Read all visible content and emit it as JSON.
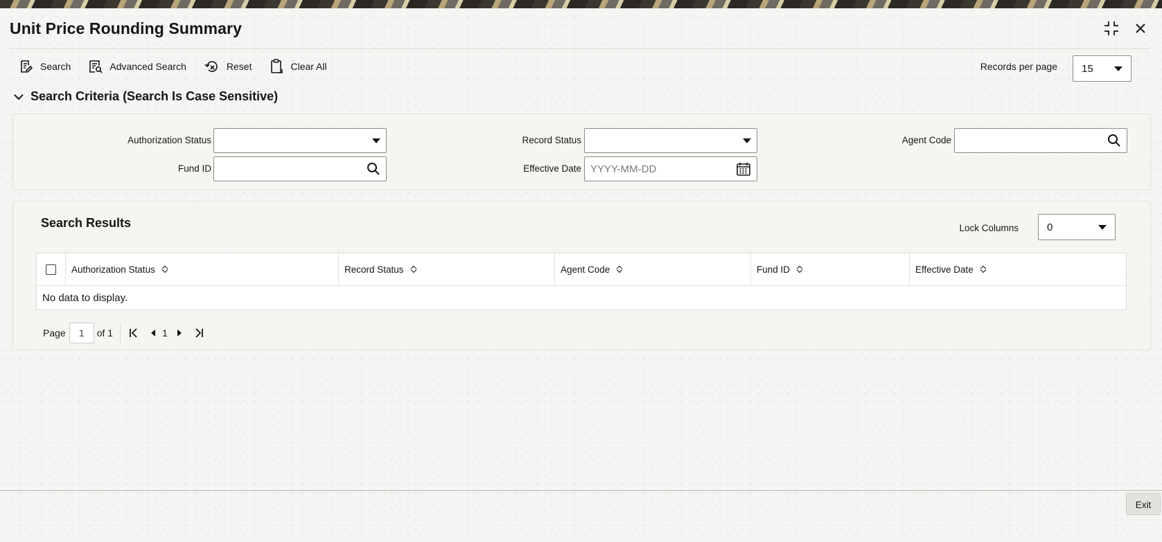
{
  "window": {
    "title": "Unit Price Rounding Summary"
  },
  "toolbar": {
    "search_label": "Search",
    "advanced_search_label": "Advanced Search",
    "reset_label": "Reset",
    "clear_all_label": "Clear All"
  },
  "records_per_page": {
    "label": "Records per page",
    "value": "15"
  },
  "criteria": {
    "heading": "Search Criteria (Search Is Case Sensitive)",
    "authorization_status": {
      "label": "Authorization Status",
      "value": ""
    },
    "record_status": {
      "label": "Record Status",
      "value": ""
    },
    "agent_code": {
      "label": "Agent Code",
      "value": ""
    },
    "fund_id": {
      "label": "Fund ID",
      "value": ""
    },
    "effective_date": {
      "label": "Effective Date",
      "placeholder": "YYYY-MM-DD"
    }
  },
  "results": {
    "heading": "Search Results",
    "lock_columns_label": "Lock Columns",
    "lock_columns_value": "0",
    "columns": [
      "Authorization Status",
      "Record Status",
      "Agent Code",
      "Fund ID",
      "Effective Date"
    ],
    "empty_message": "No data to display."
  },
  "pager": {
    "page_label": "Page",
    "page_value": "1",
    "of_label": "of 1",
    "current": "1"
  },
  "footer": {
    "exit_label": "Exit"
  }
}
